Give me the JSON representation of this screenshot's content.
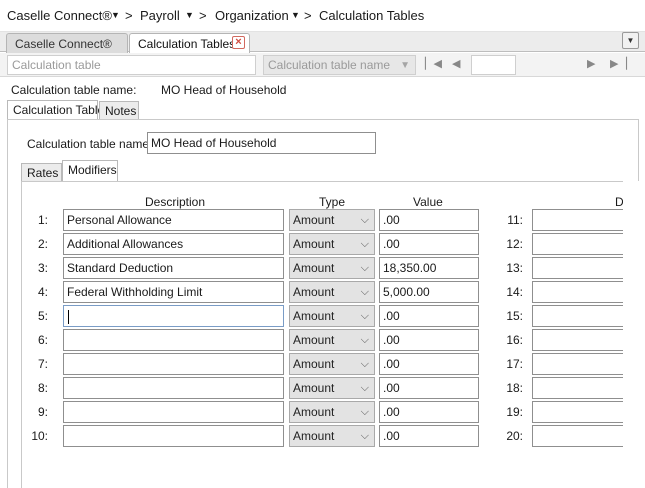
{
  "breadcrumb": {
    "items": [
      "Caselle Connect®",
      "Payroll",
      "Organization",
      "Calculation Tables"
    ],
    "separator": ">"
  },
  "tabs": [
    {
      "label": "Caselle Connect®",
      "active": false
    },
    {
      "label": "Calculation Tables",
      "active": true
    }
  ],
  "toolbar": {
    "table_placeholder": "Calculation table",
    "name_placeholder": "Calculation table name"
  },
  "header": {
    "name_label": "Calculation table name:",
    "name_value": "MO Head of Household"
  },
  "outer_tabs": [
    "Calculation Table",
    "Notes"
  ],
  "form": {
    "name_label": "Calculation table name:",
    "name_value": "MO Head of Household"
  },
  "inner_tabs": [
    "Rates",
    "Modifiers"
  ],
  "grid": {
    "col_description": "Description",
    "col_type": "Type",
    "col_value": "Value",
    "col_description_right_partial": "D",
    "rows": [
      {
        "num": "1:",
        "description": "Personal Allowance",
        "type": "Amount",
        "value": ".00"
      },
      {
        "num": "2:",
        "description": "Additional Allowances",
        "type": "Amount",
        "value": ".00"
      },
      {
        "num": "3:",
        "description": "Standard Deduction",
        "type": "Amount",
        "value": "18,350.00"
      },
      {
        "num": "4:",
        "description": "Federal Withholding Limit",
        "type": "Amount",
        "value": "5,000.00"
      },
      {
        "num": "5:",
        "description": "",
        "type": "Amount",
        "value": ".00"
      },
      {
        "num": "6:",
        "description": "",
        "type": "Amount",
        "value": ".00"
      },
      {
        "num": "7:",
        "description": "",
        "type": "Amount",
        "value": ".00"
      },
      {
        "num": "8:",
        "description": "",
        "type": "Amount",
        "value": ".00"
      },
      {
        "num": "9:",
        "description": "",
        "type": "Amount",
        "value": ".00"
      },
      {
        "num": "10:",
        "description": "",
        "type": "Amount",
        "value": ".00"
      }
    ],
    "right_rows": [
      "11:",
      "12:",
      "13:",
      "14:",
      "15:",
      "16:",
      "17:",
      "18:",
      "19:",
      "20:"
    ]
  }
}
